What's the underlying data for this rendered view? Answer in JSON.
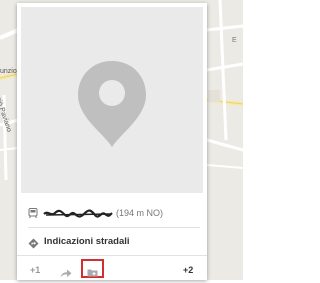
{
  "map": {
    "labels": [
      "unzio",
      "giò Paviano",
      "E"
    ]
  },
  "place_card": {
    "distance_text": "(194 m NO)",
    "directions_label": "Indicazioni stradali",
    "plus_one": "+1",
    "plus_two": "+2",
    "icons": {
      "photo_placeholder": "map-pin-placeholder-icon",
      "transit": "transit-icon",
      "directions": "directions-diamond-icon",
      "share": "share-arrow-icon",
      "save": "save-folder-icon"
    },
    "colors": {
      "highlight_border": "#d03030",
      "pin": "#bfbfbf",
      "photo_bg": "#eaeaea"
    }
  }
}
